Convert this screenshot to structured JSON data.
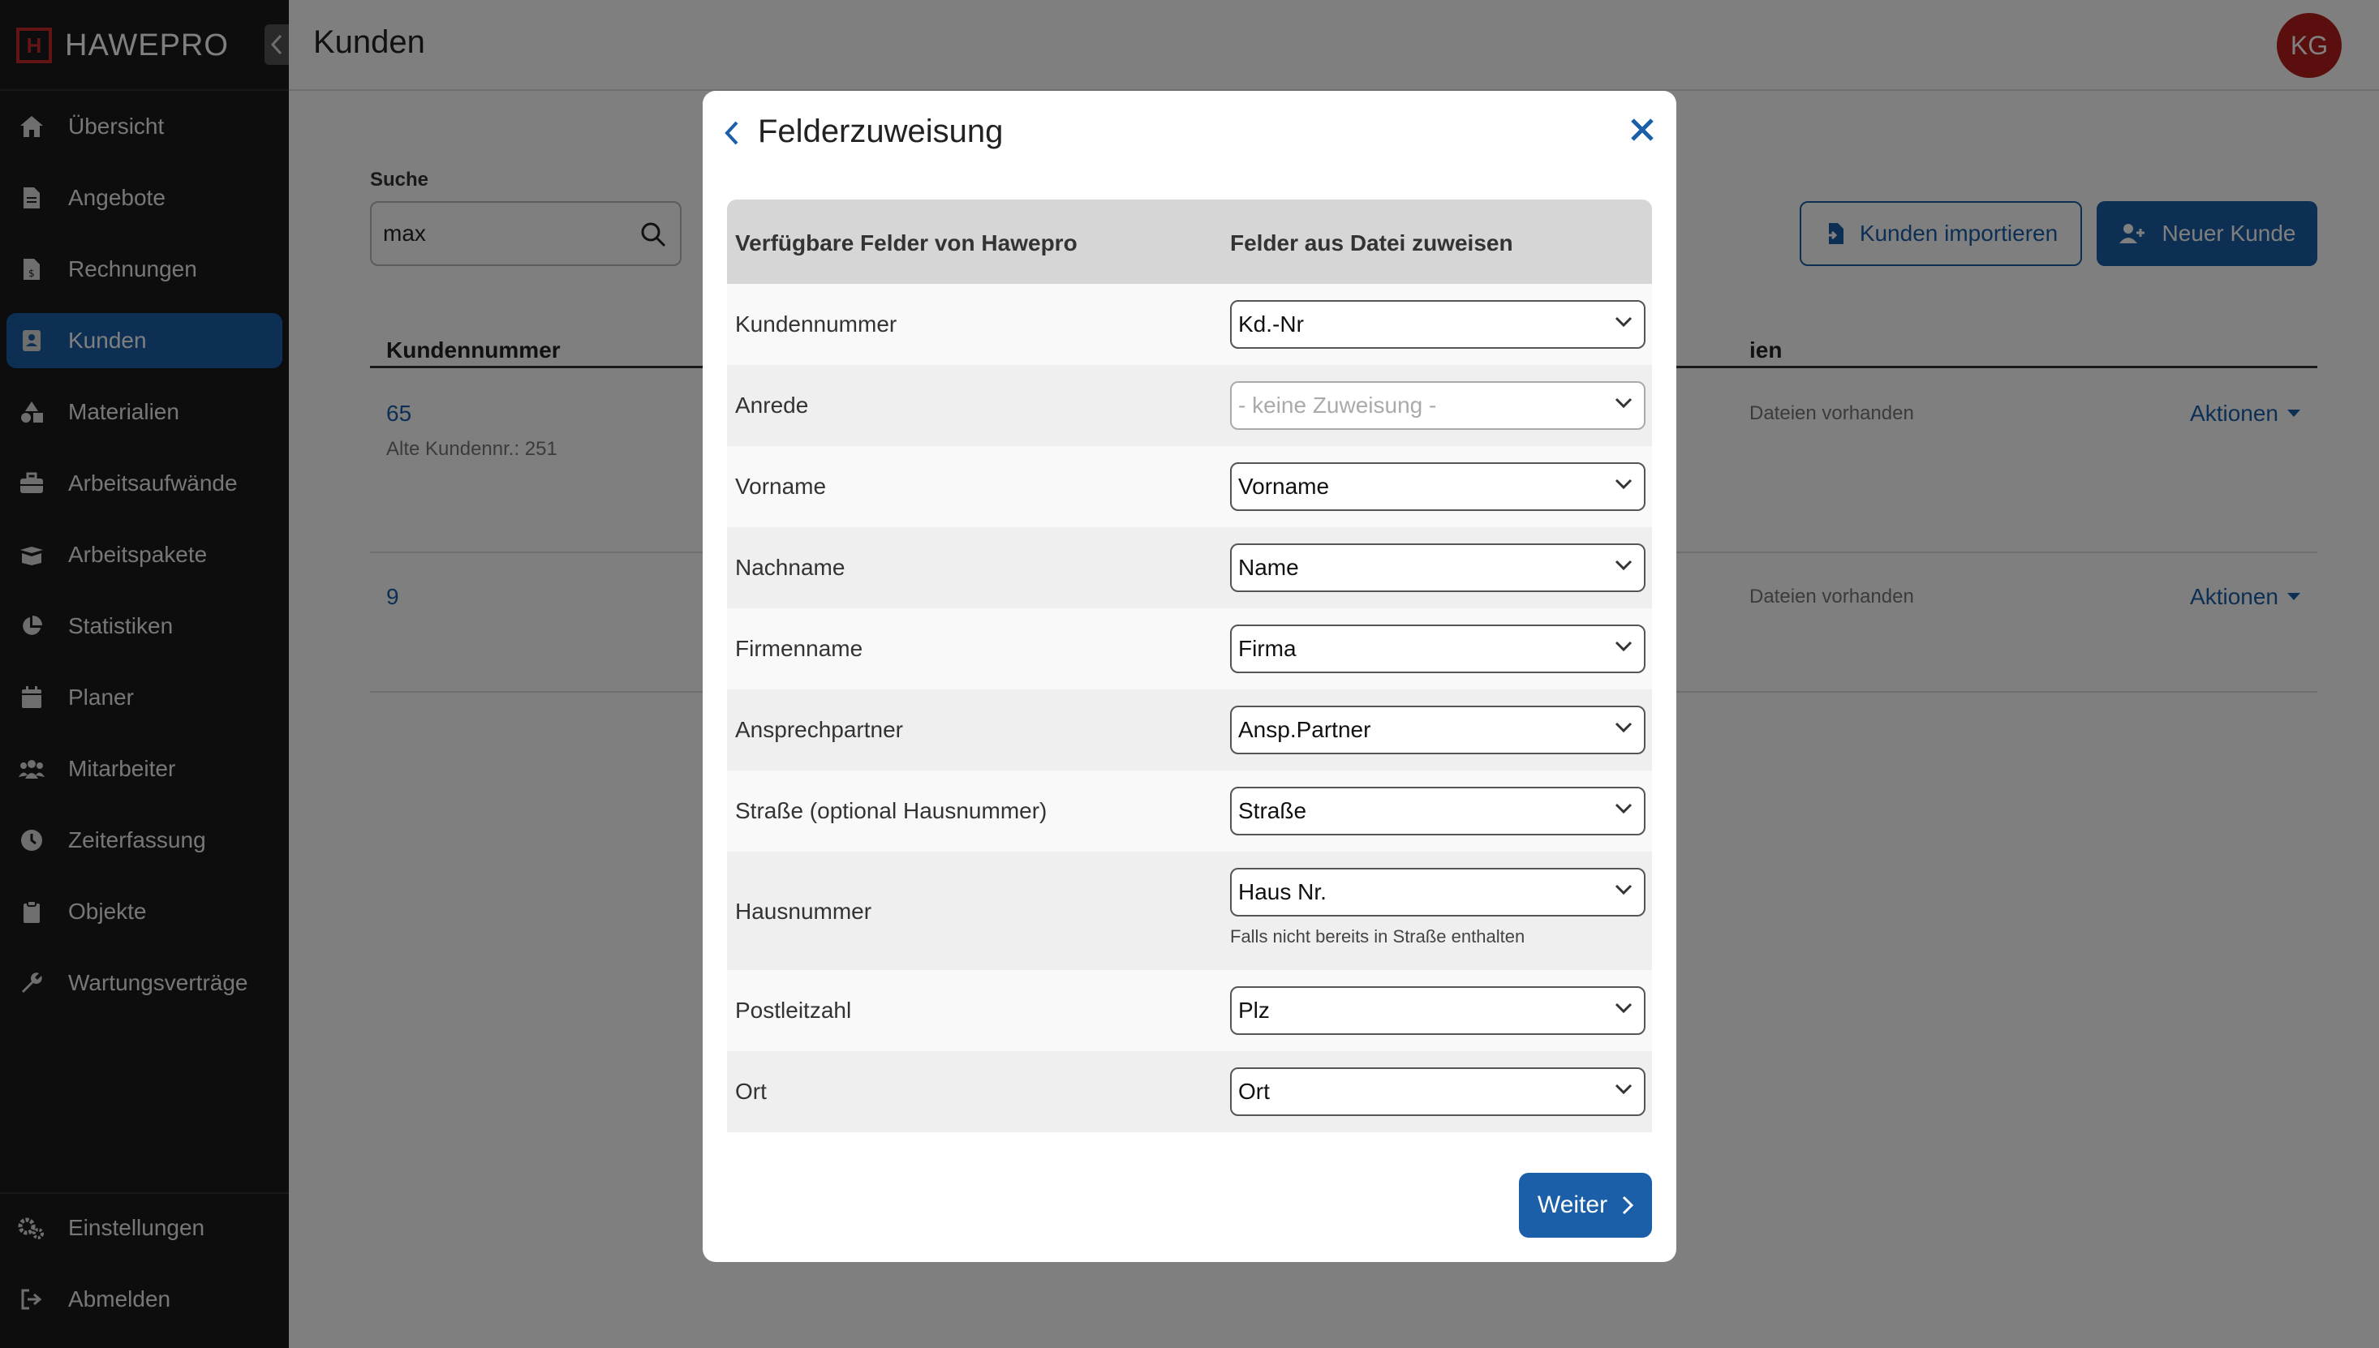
{
  "app": {
    "brand": "HAWEPRO",
    "logo_mark": "H"
  },
  "header": {
    "title": "Kunden",
    "avatar_initials": "KG"
  },
  "sidebar": {
    "items": [
      {
        "label": "Übersicht",
        "icon": "home-icon"
      },
      {
        "label": "Angebote",
        "icon": "document-icon"
      },
      {
        "label": "Rechnungen",
        "icon": "invoice-icon"
      },
      {
        "label": "Kunden",
        "icon": "contact-card-icon",
        "active": true
      },
      {
        "label": "Materialien",
        "icon": "shapes-icon"
      },
      {
        "label": "Arbeitsaufwände",
        "icon": "toolbox-icon"
      },
      {
        "label": "Arbeitspakete",
        "icon": "box-open-icon"
      },
      {
        "label": "Statistiken",
        "icon": "pie-chart-icon"
      },
      {
        "label": "Planer",
        "icon": "calendar-icon"
      },
      {
        "label": "Mitarbeiter",
        "icon": "users-icon"
      },
      {
        "label": "Zeiterfassung",
        "icon": "clock-icon"
      },
      {
        "label": "Objekte",
        "icon": "clipboard-icon"
      },
      {
        "label": "Wartungsverträge",
        "icon": "wrench-icon"
      }
    ],
    "bottom_items": [
      {
        "label": "Einstellungen",
        "icon": "gears-icon"
      },
      {
        "label": "Abmelden",
        "icon": "logout-icon"
      }
    ]
  },
  "main": {
    "search_label": "Suche",
    "search_value": "max",
    "import_button": "Kunden importieren",
    "new_button": "Neuer Kunde",
    "table": {
      "col_number": "Kundennummer",
      "col_files_partial": "ien",
      "rows": [
        {
          "number": "65",
          "sub": "Alte Kundennr.: 251",
          "files": "Dateien vorhanden",
          "actions": "Aktionen"
        },
        {
          "number": "9",
          "sub": "",
          "files": "Dateien vorhanden",
          "actions": "Aktionen"
        }
      ]
    }
  },
  "modal": {
    "title": "Felderzuweisung",
    "col_left": "Verfügbare Felder von Hawepro",
    "col_right": "Felder aus Datei zuweisen",
    "rows": [
      {
        "label": "Kundennummer",
        "value": "Kd.-Nr"
      },
      {
        "label": "Anrede",
        "value": "- keine Zuweisung -",
        "placeholder": true
      },
      {
        "label": "Vorname",
        "value": "Vorname"
      },
      {
        "label": "Nachname",
        "value": "Name"
      },
      {
        "label": "Firmenname",
        "value": "Firma"
      },
      {
        "label": "Ansprechpartner",
        "value": "Ansp.Partner"
      },
      {
        "label": "Straße (optional Hausnummer)",
        "value": "Straße"
      },
      {
        "label": "Hausnummer",
        "value": "Haus Nr.",
        "hint": "Falls nicht bereits in Straße enthalten"
      },
      {
        "label": "Postleitzahl",
        "value": "Plz"
      },
      {
        "label": "Ort",
        "value": "Ort"
      }
    ],
    "next_button": "Weiter"
  },
  "colors": {
    "accent": "#1a5fa7",
    "sidebar": "#1b1b1b",
    "avatar": "#b71c1c"
  }
}
